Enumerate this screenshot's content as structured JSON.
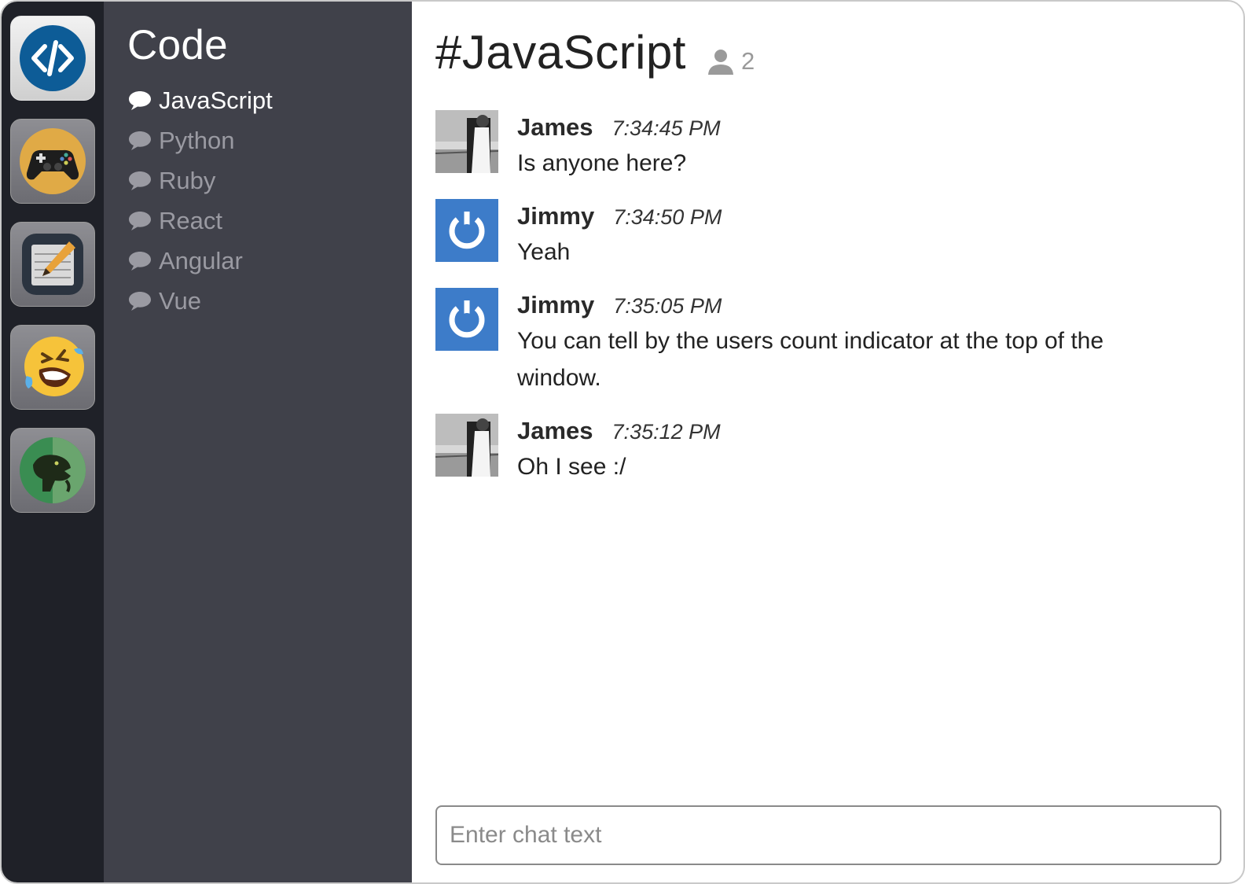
{
  "servers": [
    {
      "name": "code-server",
      "icon": "code-icon",
      "active": true
    },
    {
      "name": "gaming-server",
      "icon": "gamepad-icon",
      "active": false
    },
    {
      "name": "notes-server",
      "icon": "notepad-icon",
      "active": false
    },
    {
      "name": "funny-server",
      "icon": "laughing-emoji-icon",
      "active": false
    },
    {
      "name": "meme-server",
      "icon": "philosoraptor-icon",
      "active": false
    }
  ],
  "sidebar": {
    "group_title": "Code",
    "channels": [
      {
        "label": "JavaScript",
        "active": true
      },
      {
        "label": "Python",
        "active": false
      },
      {
        "label": "Ruby",
        "active": false
      },
      {
        "label": "React",
        "active": false
      },
      {
        "label": "Angular",
        "active": false
      },
      {
        "label": "Vue",
        "active": false
      }
    ]
  },
  "header": {
    "room_title": "#JavaScript",
    "user_count": "2"
  },
  "messages": [
    {
      "author": "James",
      "time": "7:34:45 PM",
      "text": "Is anyone here?",
      "avatar": "james"
    },
    {
      "author": "Jimmy",
      "time": "7:34:50 PM",
      "text": "Yeah",
      "avatar": "jimmy"
    },
    {
      "author": "Jimmy",
      "time": "7:35:05 PM",
      "text": "You can tell by the users count indicator at the top of the window.",
      "avatar": "jimmy"
    },
    {
      "author": "James",
      "time": "7:35:12 PM",
      "text": "Oh I see :/",
      "avatar": "james"
    }
  ],
  "composer": {
    "placeholder": "Enter chat text",
    "value": ""
  },
  "colors": {
    "rail_bg": "#1f2128",
    "sidebar_bg": "#40414a",
    "accent_blue": "#3d7cc9"
  }
}
